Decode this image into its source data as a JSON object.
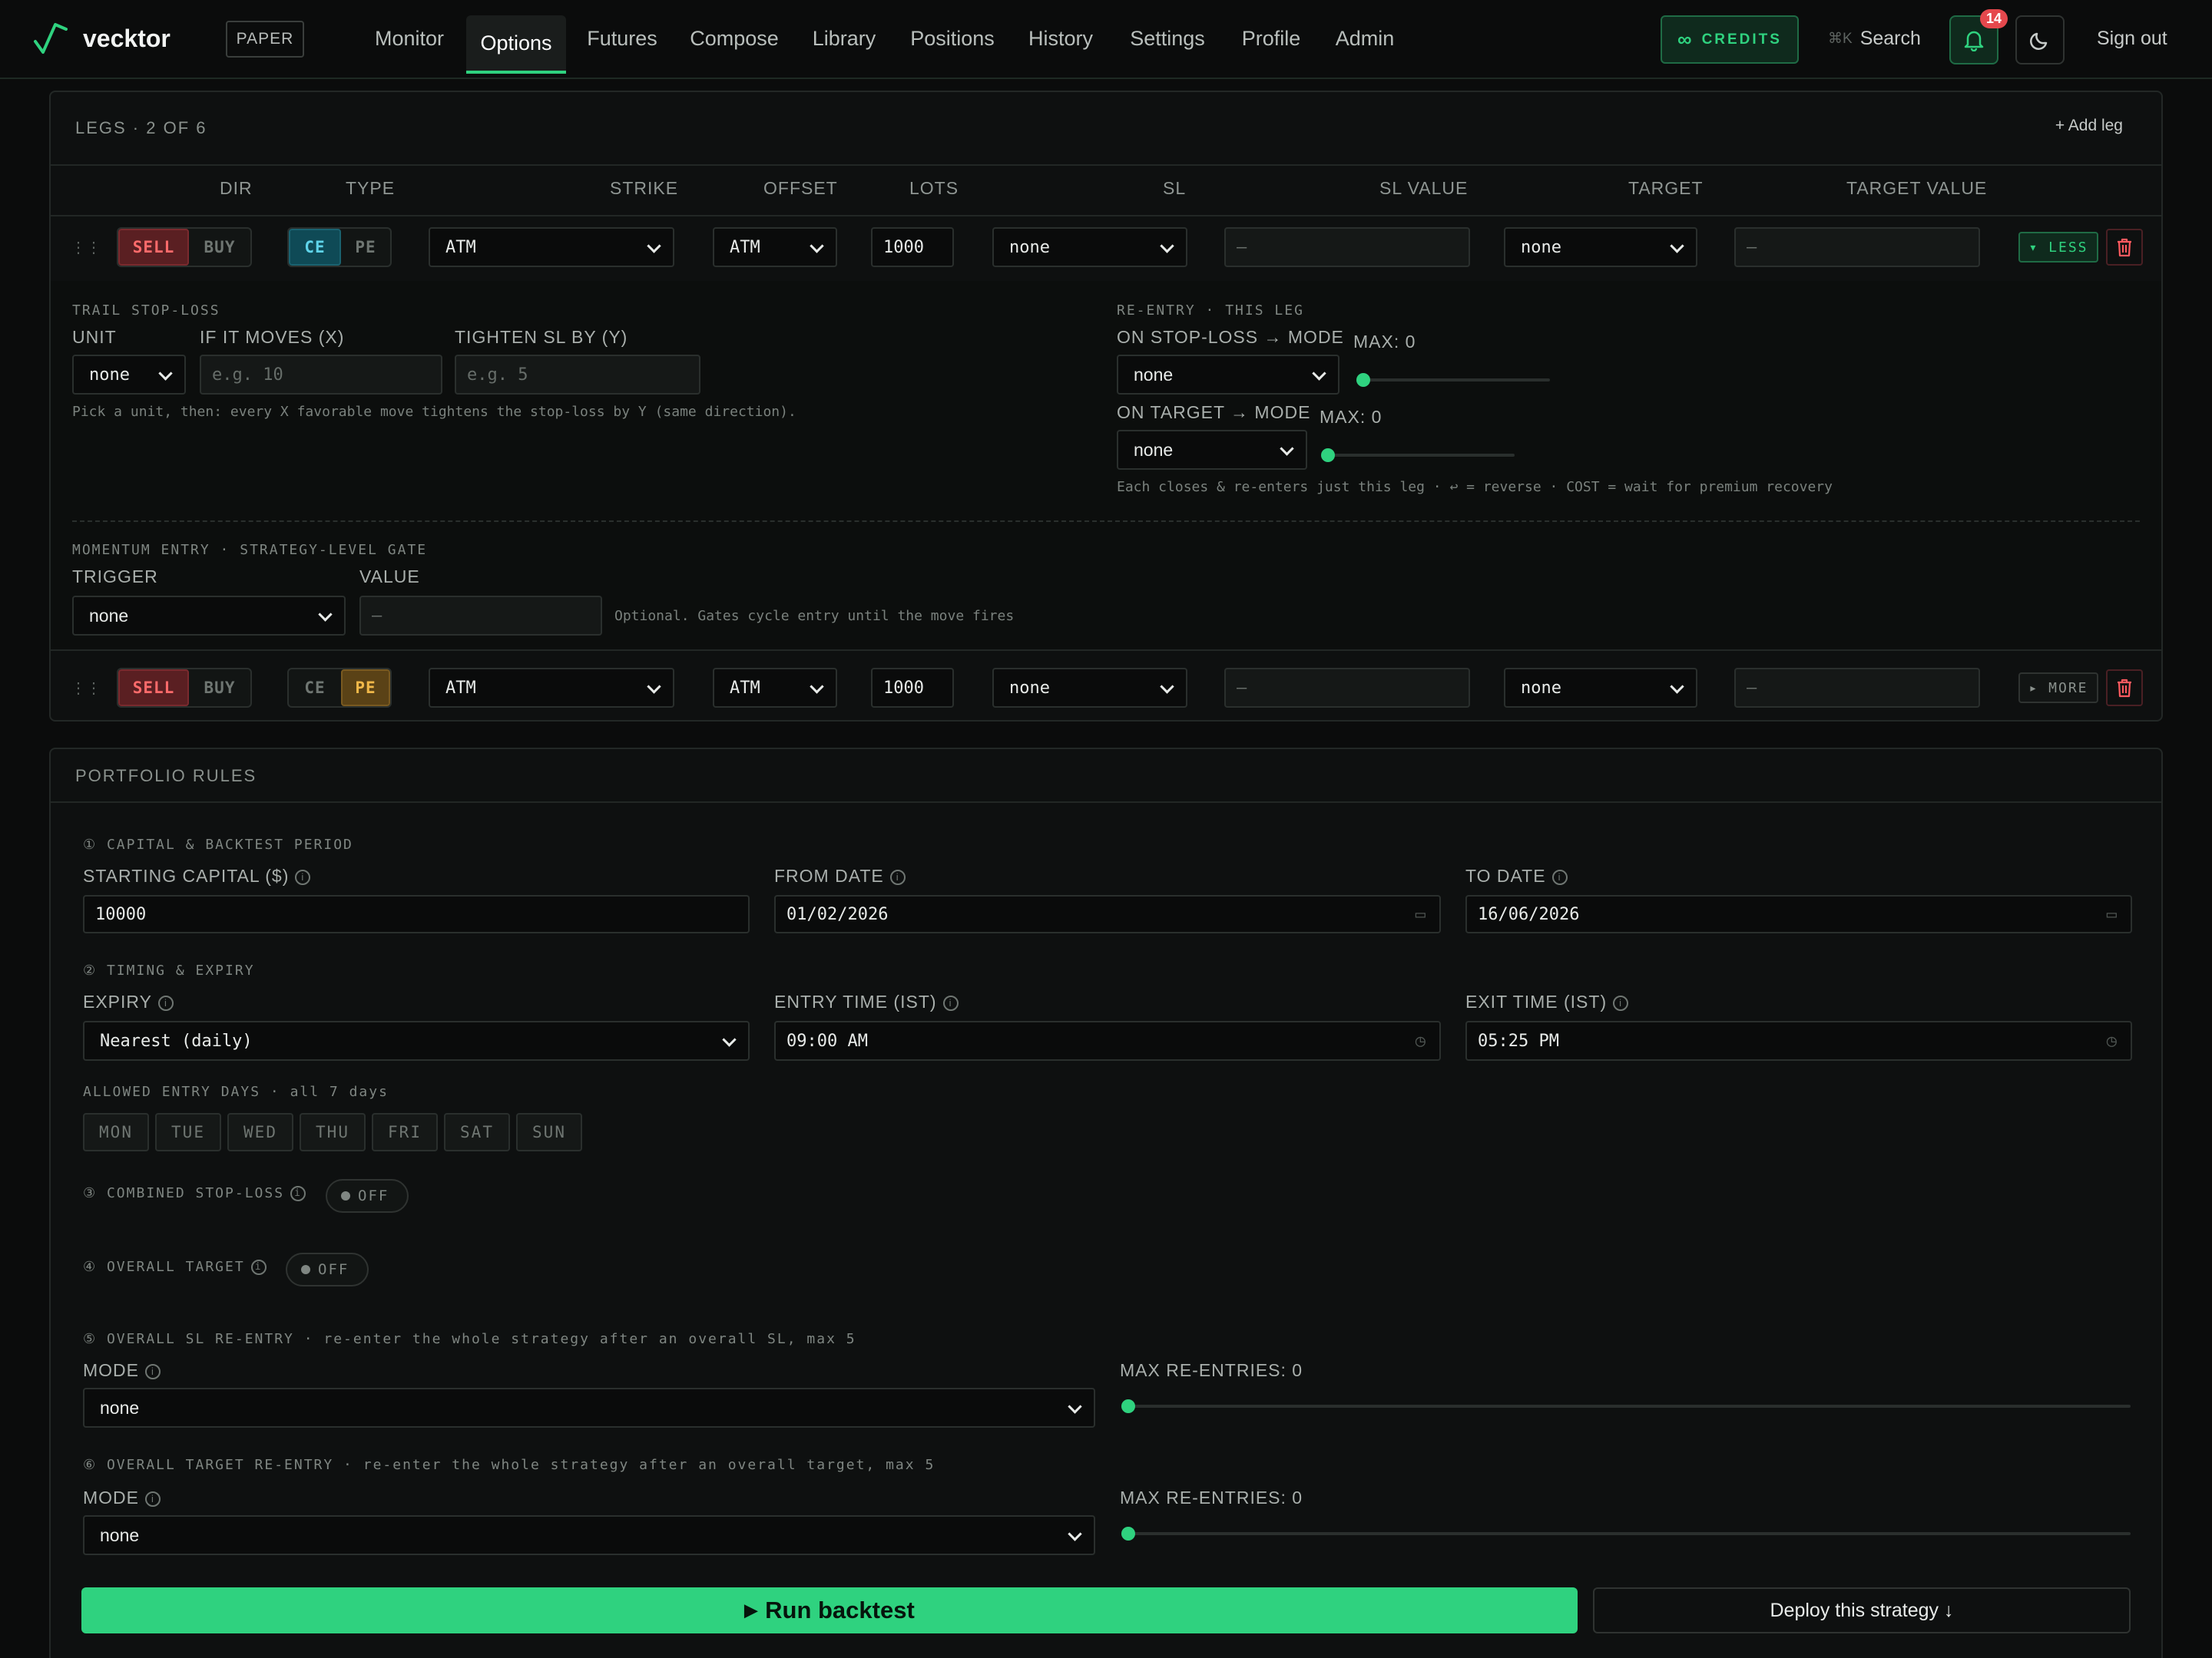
{
  "nav": {
    "brand": "vecktor",
    "mode_badge": "PAPER",
    "items": [
      "Monitor",
      "Options",
      "Futures",
      "Compose",
      "Library",
      "Positions",
      "History",
      "Settings",
      "Profile",
      "Admin"
    ],
    "active": "Options",
    "credits_label": "CREDITS",
    "search_label": "Search",
    "search_shortcut": "⌘K",
    "notifications_count": "14",
    "signout_label": "Sign out"
  },
  "legs": {
    "title": "LEGS · 2 OF 6",
    "add_label": "+ Add leg",
    "columns": [
      "DIR",
      "TYPE",
      "STRIKE",
      "OFFSET",
      "LOTS",
      "SL",
      "SL VALUE",
      "TARGET",
      "TARGET VALUE"
    ],
    "rows": [
      {
        "dir_options": [
          "SELL",
          "BUY"
        ],
        "dir": "SELL",
        "type_options": [
          "CE",
          "PE"
        ],
        "type": "CE",
        "strike": "ATM",
        "offset": "ATM",
        "lots": "1000",
        "sl": "none",
        "sl_value": "—",
        "target": "none",
        "target_value": "—",
        "toggle_label": "▾ LESS"
      },
      {
        "dir_options": [
          "SELL",
          "BUY"
        ],
        "dir": "SELL",
        "type_options": [
          "CE",
          "PE"
        ],
        "type": "PE",
        "strike": "ATM",
        "offset": "ATM",
        "lots": "1000",
        "sl": "none",
        "sl_value": "—",
        "target": "none",
        "target_value": "—",
        "toggle_label": "▸ MORE"
      }
    ],
    "trail": {
      "title": "TRAIL STOP-LOSS",
      "unit_label": "UNIT",
      "unit_value": "none",
      "moves_label": "IF IT MOVES (X)",
      "moves_placeholder": "e.g. 10",
      "tighten_label": "TIGHTEN SL BY (Y)",
      "tighten_placeholder": "e.g. 5",
      "hint": "Pick a unit, then: every X favorable move tightens the stop-loss by Y (same direction)."
    },
    "reentry": {
      "title": "RE-ENTRY · THIS LEG",
      "on_sl_label": "ON STOP-LOSS → MODE",
      "on_sl_value": "none",
      "on_sl_max_label": "MAX: 0",
      "on_sl_max": 0,
      "on_target_label": "ON TARGET → MODE",
      "on_target_value": "none",
      "on_target_max_label": "MAX: 0",
      "on_target_max": 0,
      "hint": "Each closes & re-enters just this leg · ↩ = reverse · COST = wait for premium recovery"
    },
    "momentum": {
      "title": "MOMENTUM ENTRY · STRATEGY-LEVEL GATE",
      "trigger_label": "TRIGGER",
      "trigger_value": "none",
      "value_label": "VALUE",
      "value_value": "—",
      "hint": "Optional. Gates cycle entry until the move fires"
    }
  },
  "portfolio": {
    "title": "PORTFOLIO RULES",
    "s1_title": "① CAPITAL & BACKTEST PERIOD",
    "capital_label": "STARTING CAPITAL ($)",
    "capital_value": "10000",
    "from_label": "FROM DATE",
    "from_value": "01/02/2026",
    "to_label": "TO DATE",
    "to_value": "16/06/2026",
    "s2_title": "② TIMING & EXPIRY",
    "expiry_label": "EXPIRY",
    "expiry_value": "Nearest (daily)",
    "entry_label": "ENTRY TIME (IST)",
    "entry_value": "09:00 AM",
    "exit_label": "EXIT TIME (IST)",
    "exit_value": "05:25 PM",
    "days_label": "ALLOWED ENTRY DAYS · all 7 days",
    "days": [
      "MON",
      "TUE",
      "WED",
      "THU",
      "FRI",
      "SAT",
      "SUN"
    ],
    "s3_title": "③ COMBINED STOP-LOSS",
    "s3_toggle": "OFF",
    "s4_title": "④ OVERALL TARGET",
    "s4_toggle": "OFF",
    "s5_title": "⑤ OVERALL SL RE-ENTRY · re-enter the whole strategy after an overall SL, max 5",
    "s5_mode_label": "MODE",
    "s5_mode_value": "none",
    "s5_max_label": "MAX RE-ENTRIES: 0",
    "s5_max": 0,
    "s6_title": "⑥ OVERALL TARGET RE-ENTRY · re-enter the whole strategy after an overall target, max 5",
    "s6_mode_label": "MODE",
    "s6_mode_value": "none",
    "s6_max_label": "MAX RE-ENTRIES: 0",
    "s6_max": 0
  },
  "actions": {
    "run_label": "Run backtest",
    "deploy_label": "Deploy this strategy ↓"
  },
  "colors": {
    "accent": "#2fd27f",
    "danger": "#ff6b6b",
    "ce": "#5fd4ea",
    "pe": "#f0b849",
    "bg": "#0b0c0c"
  }
}
